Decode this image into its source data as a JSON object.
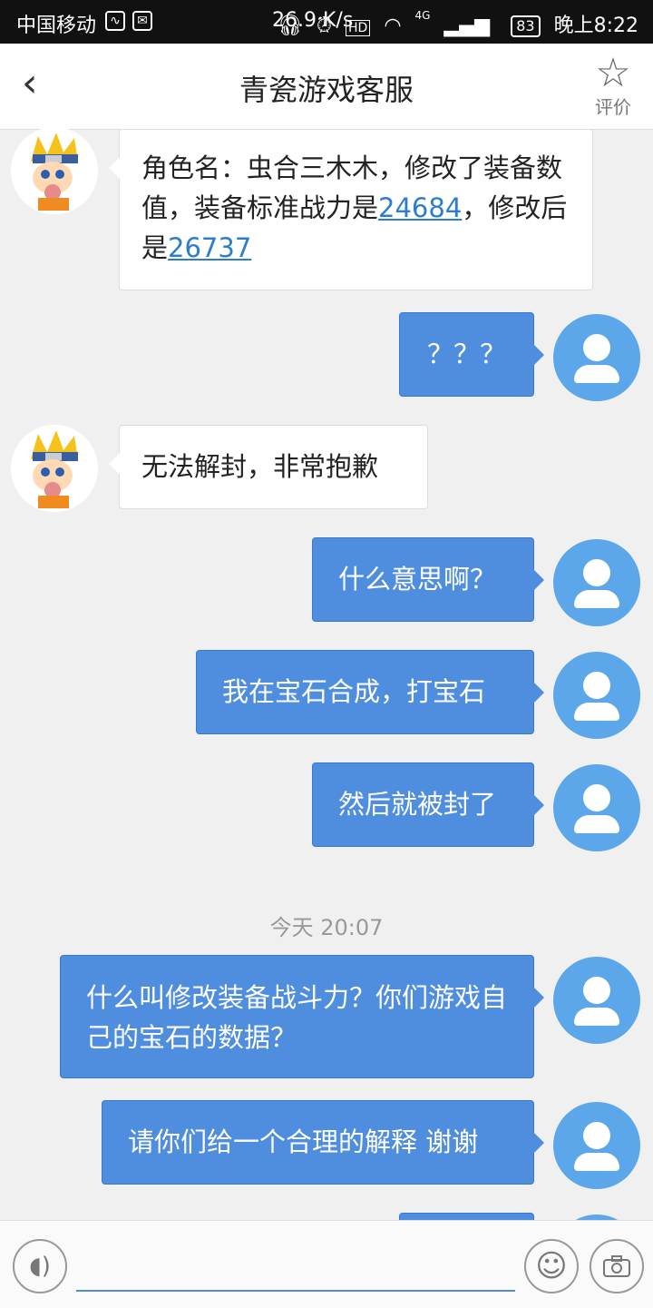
{
  "status_bar": {
    "carrier": "中国移动",
    "speed": "26.9 K/s",
    "network": "4G",
    "hd": "HD",
    "battery": "83",
    "time": "晚上8:22"
  },
  "header": {
    "title": "青瓷游戏客服",
    "rate_label": "评价"
  },
  "messages": [
    {
      "from": "agent",
      "text_a": "角色名：虫合三木木，修改了装备数值，装备标准战力是",
      "link1": "24684",
      "text_b": "，修改后是",
      "link2": "26737"
    },
    {
      "from": "user",
      "text": "？？？"
    },
    {
      "from": "agent",
      "text": "无法解封，非常抱歉"
    },
    {
      "from": "user",
      "text": "什么意思啊？"
    },
    {
      "from": "user",
      "text": "我在宝石合成，打宝石"
    },
    {
      "from": "user",
      "text": "然后就被封了"
    },
    {
      "from": "user",
      "text": "什么叫修改装备战斗力？你们游戏自己的宝石的数据？"
    },
    {
      "from": "user",
      "text": "请你们给一个合理的解释 谢谢"
    }
  ],
  "timestamp": "今天 20:07",
  "input": {
    "placeholder": ""
  },
  "colors": {
    "accent": "#4f8ddf",
    "user_avatar": "#5ba7ea",
    "link": "#2c7ccf"
  }
}
